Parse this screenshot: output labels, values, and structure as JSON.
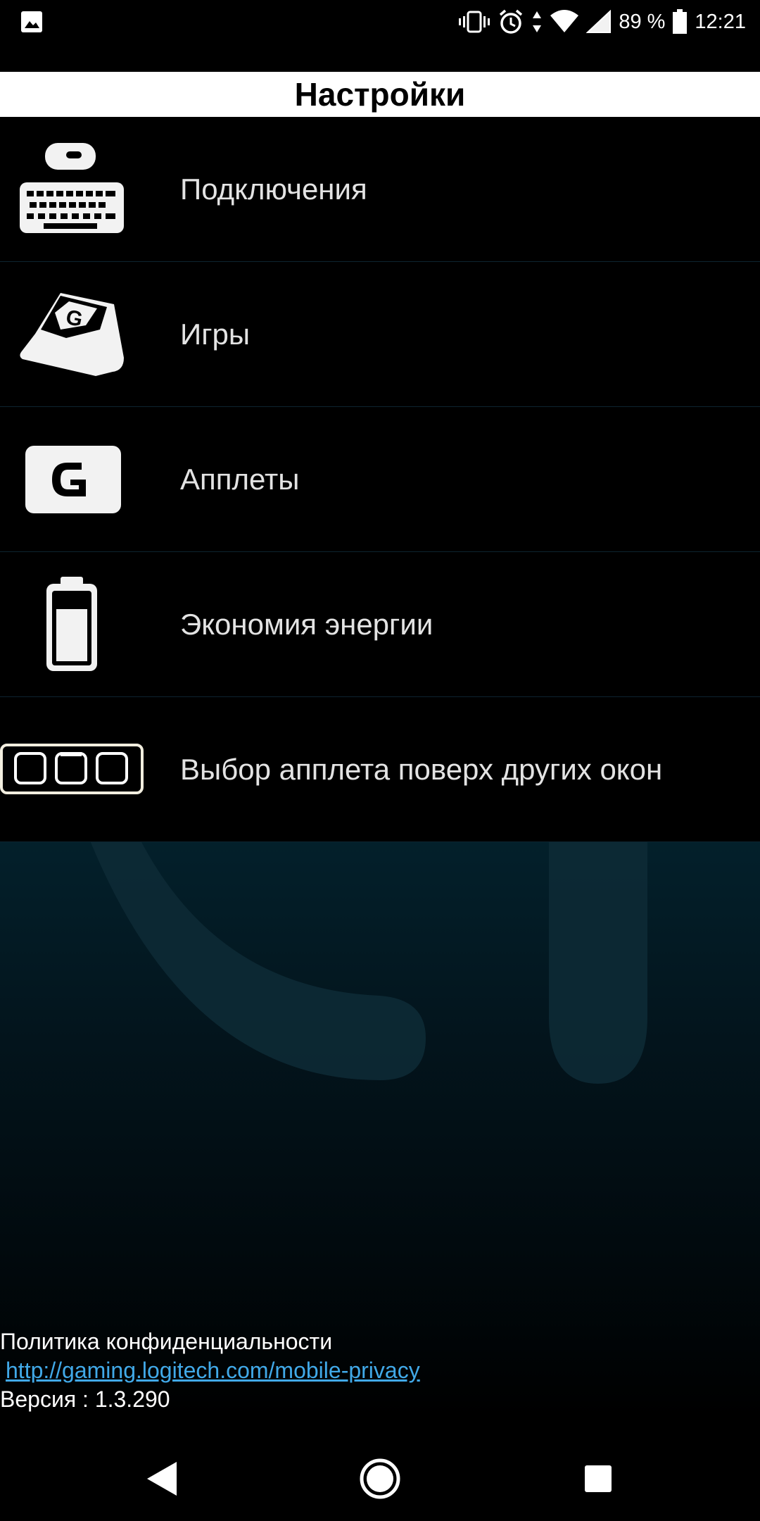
{
  "status_bar": {
    "battery": "89 %",
    "time": "12:21"
  },
  "header": {
    "title": "Настройки"
  },
  "menu": {
    "items": [
      {
        "label": "Подключения",
        "icon": "keyboard-mouse-icon"
      },
      {
        "label": "Игры",
        "icon": "g-key-icon"
      },
      {
        "label": "Апплеты",
        "icon": "logitech-g-icon"
      },
      {
        "label": "Экономия энергии",
        "icon": "battery-icon"
      },
      {
        "label": "Выбор апплета поверх других окон",
        "icon": "applet-overlay-icon"
      }
    ]
  },
  "footer": {
    "privacy_label": "Политика конфиденциальности",
    "privacy_link": "http://gaming.logitech.com/mobile-privacy",
    "version": "Версия : 1.3.290"
  },
  "colors": {
    "background": "#000000",
    "title_bar": "#ffffff",
    "link": "#41a9e8",
    "label_text": "#e3e3e3"
  }
}
